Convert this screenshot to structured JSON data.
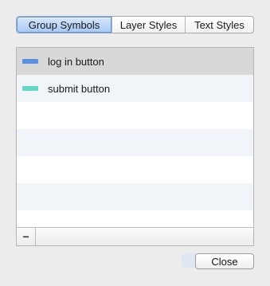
{
  "tabs": [
    {
      "label": "Group Symbols",
      "selected": true
    },
    {
      "label": "Layer Styles",
      "selected": false
    },
    {
      "label": "Text Styles",
      "selected": false
    }
  ],
  "list": {
    "items": [
      {
        "label": "log in button",
        "thumb_color": "#5b8fe0",
        "selected": true
      },
      {
        "label": "submit button",
        "thumb_color": "#63d6c4",
        "selected": false
      }
    ],
    "remove_label": "−"
  },
  "footer": {
    "close_label": "Close"
  },
  "colors": {
    "selected_tab_accent": "#5a94e6",
    "selected_row": "#d8d8d8",
    "alt_row": "#f1f5fa"
  }
}
